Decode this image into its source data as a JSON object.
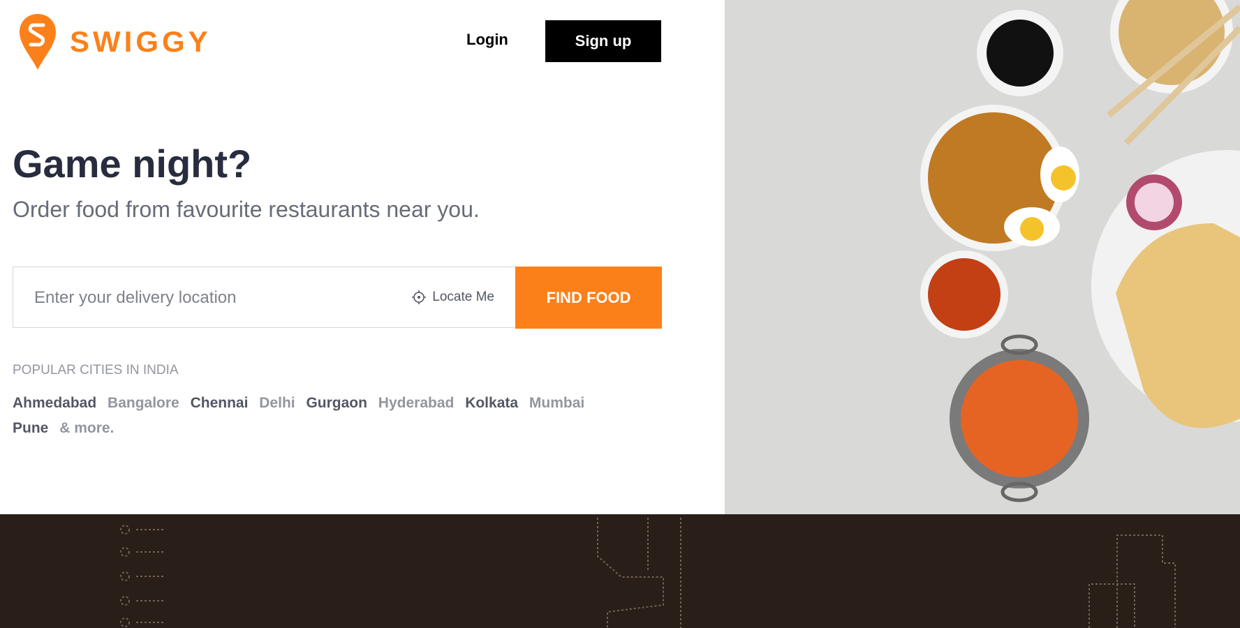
{
  "brand": {
    "name": "SWIGGY",
    "color": "#fc8019"
  },
  "header": {
    "login_label": "Login",
    "signup_label": "Sign up"
  },
  "hero": {
    "title": "Game night?",
    "subtitle": "Order food from favourite restaurants near you."
  },
  "search": {
    "placeholder": "Enter your delivery location",
    "locate_label": "Locate Me",
    "find_label": "FIND FOOD"
  },
  "popular": {
    "heading": "POPULAR CITIES IN INDIA",
    "cities": [
      "Ahmedabad",
      "Bangalore",
      "Chennai",
      "Delhi",
      "Gurgaon",
      "Hyderabad",
      "Kolkata",
      "Mumbai",
      "Pune"
    ],
    "more_label": "& more."
  }
}
